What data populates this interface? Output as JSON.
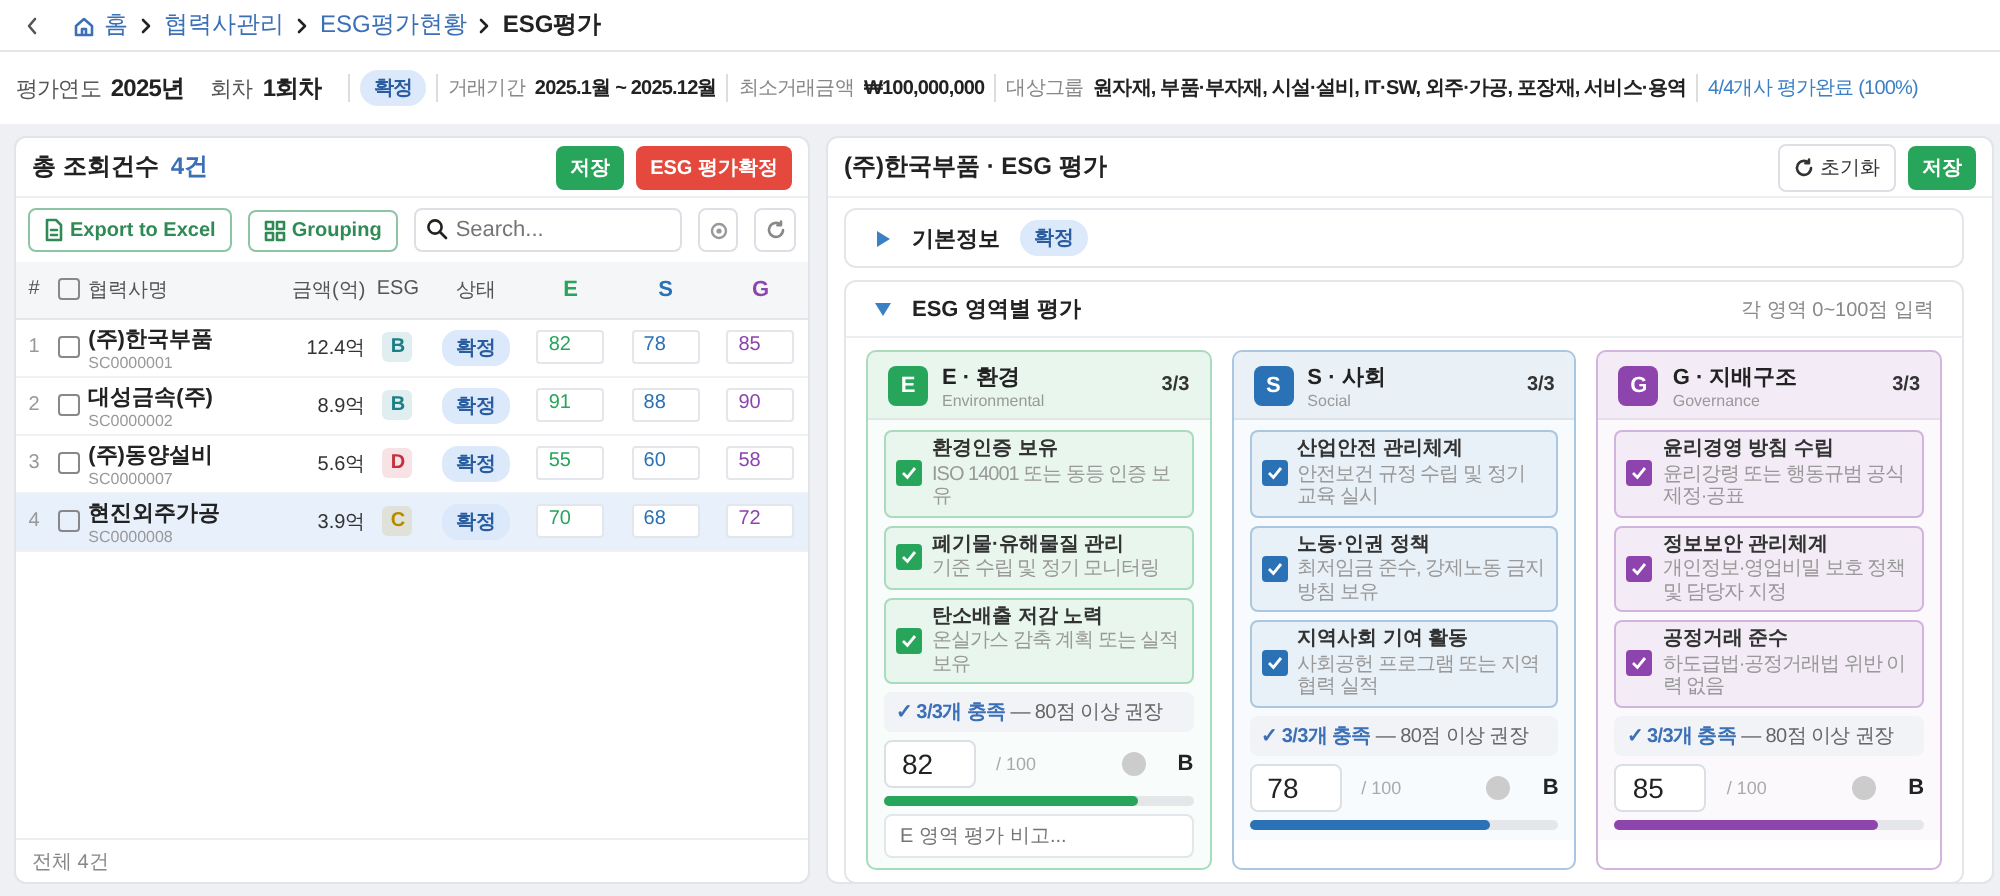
{
  "breadcrumb": [
    {
      "label": "홈",
      "kind": "home"
    },
    {
      "label": "협력사관리",
      "kind": "link"
    },
    {
      "label": "ESG평가현황",
      "kind": "link"
    },
    {
      "label": "ESG평가",
      "kind": "current"
    }
  ],
  "info_bar": {
    "fields": [
      {
        "label": "평가연도",
        "value": "2025년",
        "kind": "large"
      },
      {
        "label": "회차",
        "value": "1회차",
        "kind": "large"
      },
      {
        "badge": "확정",
        "kind": "badge"
      },
      {
        "label": "거래기간",
        "value": "2025.1월 ~ 2025.12월",
        "kind": "small"
      },
      {
        "label": "최소거래금액",
        "value": "₩100,000,000",
        "kind": "small"
      },
      {
        "label": "대상그룹",
        "value": "원자재, 부품·부자재, 시설·설비, IT·SW, 외주·가공, 포장재, 서비스·용역",
        "kind": "small"
      }
    ],
    "progress": "4/4개사 평가완료 (100%)"
  },
  "list_panel": {
    "title": "총 조회건수",
    "count": "4건",
    "buttons": [
      {
        "label": "저장",
        "kind": "save"
      },
      {
        "label": "ESG 평가확정",
        "kind": "confirm"
      }
    ],
    "toolbar": {
      "buttons": [
        {
          "label": "Export to Excel",
          "kind": "excel"
        },
        {
          "label": "Grouping",
          "kind": "grid"
        }
      ],
      "search": {
        "placeholder": "Search..."
      }
    },
    "table": {
      "columns": [
        {
          "label": "#",
          "kind": "num"
        },
        {
          "kind": "check",
          "checked": false
        },
        {
          "label": "협력사명",
          "kind": "name"
        },
        {
          "label": "금액(억)",
          "kind": "amount"
        },
        {
          "label": "ESG",
          "kind": "grade"
        },
        {
          "label": "상태",
          "kind": "status"
        },
        {
          "label": "E",
          "kind": "e"
        },
        {
          "label": "S",
          "kind": "s"
        },
        {
          "label": "G",
          "kind": "g"
        }
      ],
      "rows": [
        {
          "num": "1",
          "checked": false,
          "selected": false,
          "name": "(주)한국부품",
          "code": "SC0000001",
          "amount": "12.4억",
          "grade": {
            "label": "B",
            "color": "#1a7f86"
          },
          "status": "확정",
          "e": "82",
          "s": "78",
          "g": "85"
        },
        {
          "num": "2",
          "checked": false,
          "selected": false,
          "name": "대성금속(주)",
          "code": "SC0000002",
          "amount": "8.9억",
          "grade": {
            "label": "B",
            "color": "#1a7f86"
          },
          "status": "확정",
          "e": "91",
          "s": "88",
          "g": "90"
        },
        {
          "num": "3",
          "checked": false,
          "selected": false,
          "name": "(주)동양설비",
          "code": "SC0000007",
          "amount": "5.6억",
          "grade": {
            "label": "D",
            "color": "#c62f3b"
          },
          "status": "확정",
          "e": "55",
          "s": "60",
          "g": "58"
        },
        {
          "num": "4",
          "checked": false,
          "selected": true,
          "name": "현진외주가공",
          "code": "SC0000008",
          "amount": "3.9억",
          "grade": {
            "label": "C",
            "color": "#b58a00"
          },
          "status": "확정",
          "e": "70",
          "s": "68",
          "g": "72"
        }
      ]
    },
    "footer": "전체 4건"
  },
  "detail_panel": {
    "title": "(주)한국부품 · ESG 평가",
    "buttons": [
      {
        "label": "초기화",
        "kind": "reset"
      },
      {
        "label": "저장",
        "kind": "save"
      }
    ],
    "sections": [
      {
        "title": "기본정보",
        "badge": "확정",
        "expanded": false
      },
      {
        "title": "ESG 영역별 평가",
        "hint": "각 영역 0~100점 입력",
        "expanded": true
      }
    ],
    "cards": [
      {
        "letter": "E",
        "title": "E · 환경",
        "subtitle": "Environmental",
        "count": "3/3",
        "color": "#27a55b",
        "items": [
          {
            "title": "환경인증 보유",
            "desc": "ISO 14001 또는 동등 인증 보유",
            "checked": true
          },
          {
            "title": "폐기물·유해물질 관리",
            "desc": "기준 수립 및 정기 모니터링",
            "checked": true
          },
          {
            "title": "탄소배출 저감 노력",
            "desc": "온실가스 감축 계획 또는 실적 보유",
            "checked": true
          }
        ],
        "summary": "**✓ 3/3개 충족** — 80점 이상 권장",
        "score": "82",
        "max": "/ 100",
        "grade": "B",
        "level": 0.82,
        "note": {
          "placeholder": "E 영역 평가 비고..."
        }
      },
      {
        "letter": "S",
        "title": "S · 사회",
        "subtitle": "Social",
        "count": "3/3",
        "color": "#2a72b5",
        "items": [
          {
            "title": "산업안전 관리체계",
            "desc": "안전보건 규정 수립 및 정기 교육 실시",
            "checked": true
          },
          {
            "title": "노동·인권 정책",
            "desc": "최저임금 준수, 강제노동 금지 방침 보유",
            "checked": true
          },
          {
            "title": "지역사회 기여 활동",
            "desc": "사회공헌 프로그램 또는 지역 협력 실적",
            "checked": true
          }
        ],
        "summary": "**✓ 3/3개 충족** — 80점 이상 권장",
        "score": "78",
        "max": "/ 100",
        "grade": "B",
        "level": 0.78
      },
      {
        "letter": "G",
        "title": "G · 지배구조",
        "subtitle": "Governance",
        "count": "3/3",
        "color": "#8e44ad",
        "items": [
          {
            "title": "윤리경영 방침 수립",
            "desc": "윤리강령 또는 행동규범 공식 제정·공표",
            "checked": true
          },
          {
            "title": "정보보안 관리체계",
            "desc": "개인정보·영업비밀 보호 정책 및 담당자 지정",
            "checked": true
          },
          {
            "title": "공정거래 준수",
            "desc": "하도급법·공정거래법 위반 이력 없음",
            "checked": true
          }
        ],
        "summary": "**✓ 3/3개 충족** — 80점 이상 권장",
        "score": "85",
        "max": "/ 100",
        "grade": "B",
        "level": 0.85
      }
    ]
  }
}
